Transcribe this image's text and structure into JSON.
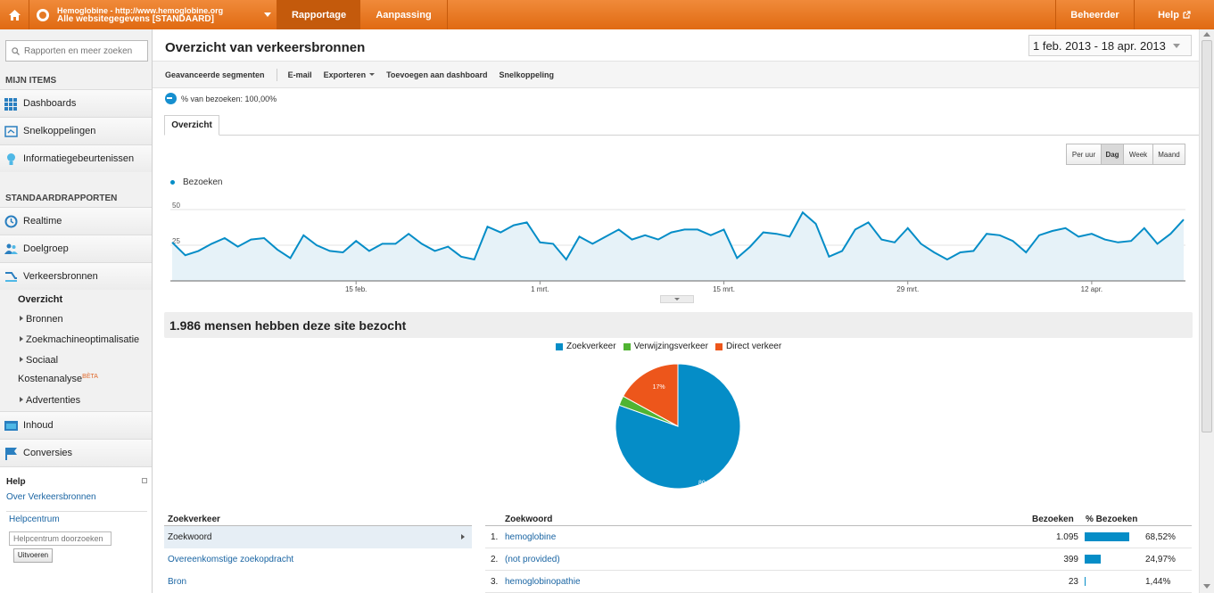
{
  "topbar": {
    "account_line1": "Hemoglobine - http://www.hemoglobine.org",
    "account_line2": "Alle websitegegevens [STANDAARD]",
    "tab_rapportage": "Rapportage",
    "tab_aanpassing": "Aanpassing",
    "beheerder": "Beheerder",
    "help": "Help"
  },
  "sidebar": {
    "search_placeholder": "Rapporten en meer zoeken",
    "mijn_items": "MIJN ITEMS",
    "dashboards": "Dashboards",
    "snelkoppelingen": "Snelkoppelingen",
    "informatie": "Informatiegebeurtenissen",
    "standaard": "STANDAARDRAPPORTEN",
    "realtime": "Realtime",
    "doelgroep": "Doelgroep",
    "verkeersbronnen": "Verkeersbronnen",
    "overzicht": "Overzicht",
    "bronnen": "Bronnen",
    "zoekmachine": "Zoekmachineoptimalisatie",
    "sociaal": "Sociaal",
    "kosten": "Kostenanalyse",
    "beta": "BÈTA",
    "advertenties": "Advertenties",
    "inhoud": "Inhoud",
    "conversies": "Conversies",
    "help_title": "Help",
    "over_link": "Over Verkeersbronnen",
    "helpcentrum": "Helpcentrum",
    "hc_placeholder": "Helpcentrum doorzoeken",
    "uitvoeren": "Uitvoeren"
  },
  "main": {
    "title": "Overzicht van verkeersbronnen",
    "daterange": "1 feb. 2013 - 18 apr. 2013",
    "toolbar": {
      "segmenten": "Geavanceerde segmenten",
      "email": "E-mail",
      "exporteren": "Exporteren",
      "toevoegen": "Toevoegen aan dashboard",
      "snelkoppeling": "Snelkoppeling"
    },
    "segment_text": "% van bezoeken: 100,00%",
    "tab_overzicht": "Overzicht",
    "granularity": [
      "Per uur",
      "Dag",
      "Week",
      "Maand"
    ],
    "visitors_banner": "1.986 mensen hebben deze site bezocht"
  },
  "chart_data": [
    {
      "type": "area",
      "series": [
        {
          "name": "Bezoeken",
          "values": [
            27,
            18,
            21,
            26,
            30,
            24,
            29,
            30,
            22,
            16,
            32,
            25,
            21,
            20,
            28,
            21,
            26,
            26,
            33,
            26,
            21,
            24,
            17,
            15,
            38,
            34,
            39,
            41,
            27,
            26,
            15,
            31,
            26,
            31,
            36,
            29,
            32,
            29,
            34,
            36,
            36,
            32,
            36,
            16,
            24,
            34,
            33,
            31,
            48,
            40,
            17,
            21,
            36,
            41,
            29,
            27,
            37,
            26,
            20,
            15,
            20,
            21,
            33,
            32,
            28,
            20,
            32,
            35,
            37,
            31,
            33,
            29,
            27,
            28,
            37,
            26,
            33,
            43
          ],
          "color": "#058dc7"
        }
      ],
      "x_tick_labels": [
        "15 feb.",
        "1 mrt.",
        "15 mrt.",
        "29 mrt.",
        "12 apr."
      ],
      "y_tick_labels": [
        "25",
        "50"
      ],
      "ylim": [
        0,
        60
      ]
    },
    {
      "type": "pie",
      "labels": [
        "Zoekverkeer",
        "Verwijzingsverkeer",
        "Direct verkeer"
      ],
      "values": [
        80.5,
        2.5,
        17
      ],
      "slice_labels": [
        "80.5%",
        "",
        "17%"
      ],
      "colors": [
        "#058dc7",
        "#50b432",
        "#ed561b"
      ]
    }
  ],
  "left_table": {
    "header": "Zoekverkeer",
    "rows": [
      "Zoekwoord",
      "Overeenkomstige zoekopdracht",
      "Bron"
    ]
  },
  "right_table": {
    "headers": {
      "keyword": "Zoekwoord",
      "visits": "Bezoeken",
      "pct": "% Bezoeken"
    },
    "rows": [
      {
        "idx": "1.",
        "keyword": "hemoglobine",
        "visits": "1.095",
        "pct": "68,52%",
        "share": 0.6852
      },
      {
        "idx": "2.",
        "keyword": "(not provided)",
        "visits": "399",
        "pct": "24,97%",
        "share": 0.2497
      },
      {
        "idx": "3.",
        "keyword": "hemoglobinopathie",
        "visits": "23",
        "pct": "1,44%",
        "share": 0.0144
      }
    ]
  }
}
